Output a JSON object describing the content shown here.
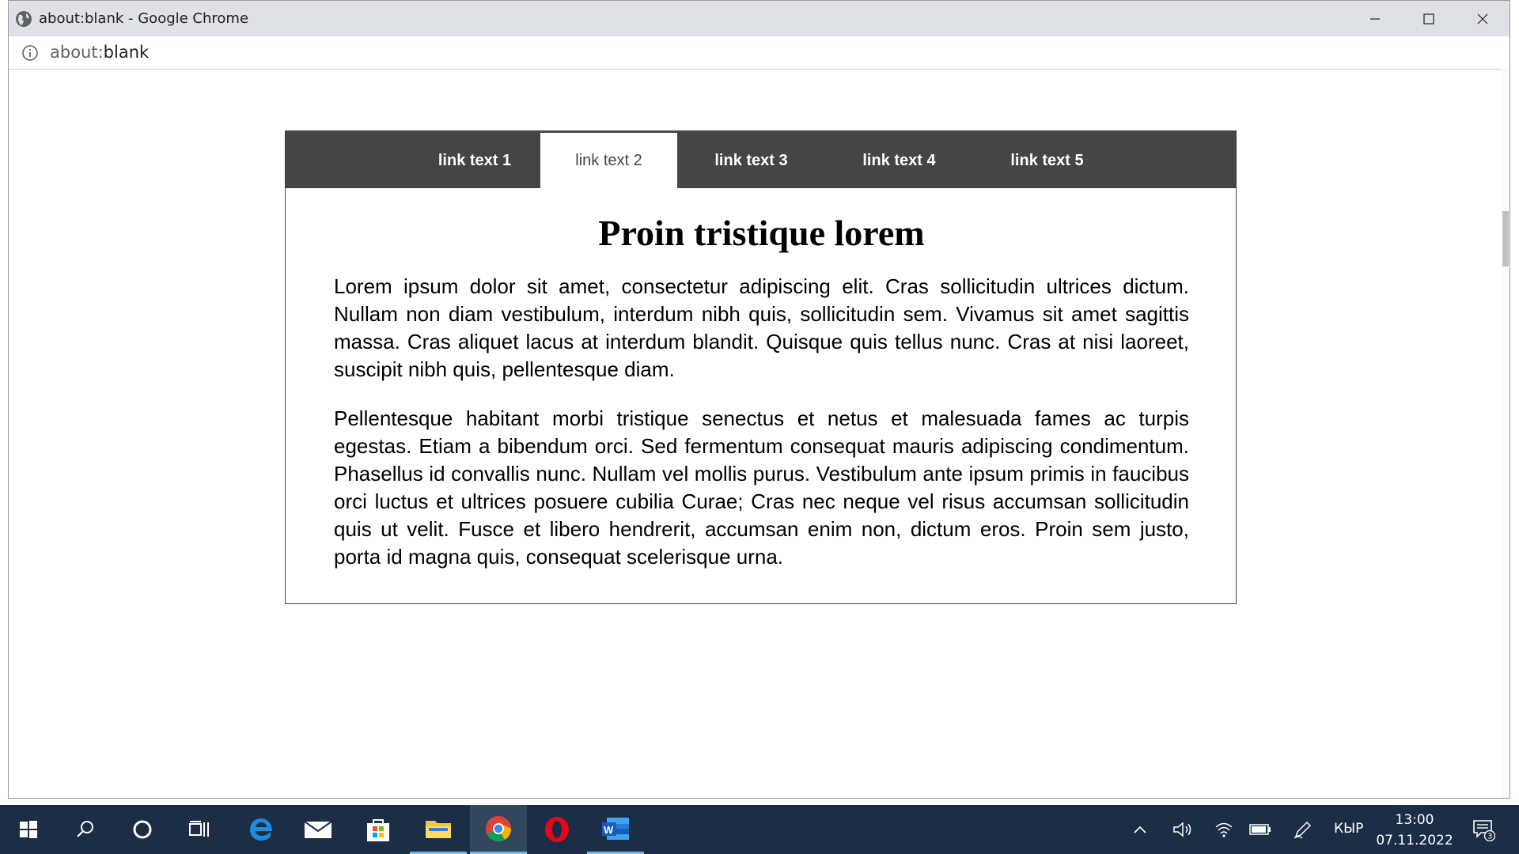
{
  "window": {
    "title": "about:blank - Google Chrome",
    "url_prefix": "about:",
    "url_suffix": "blank"
  },
  "nav": {
    "links": [
      {
        "label": "link text 1",
        "active": false
      },
      {
        "label": "link text 2",
        "active": true
      },
      {
        "label": "link text 3",
        "active": false
      },
      {
        "label": "link text 4",
        "active": false
      },
      {
        "label": "link text 5",
        "active": false
      }
    ]
  },
  "content": {
    "heading": "Proin tristique lorem",
    "paragraphs": [
      "Lorem ipsum dolor sit amet, consectetur adipiscing elit. Cras sollicitudin ultrices dictum. Nullam non diam vestibulum, interdum nibh quis, sollicitudin sem. Vivamus sit amet sagittis massa. Cras aliquet lacus at interdum blandit. Quisque quis tellus nunc. Cras at nisi laoreet, suscipit nibh quis, pellentesque diam.",
      "Pellentesque habitant morbi tristique senectus et netus et malesuada fames ac turpis egestas. Etiam a bibendum orci. Sed fermentum consequat mauris adipiscing condimentum. Phasellus id convallis nunc. Nullam vel mollis purus. Vestibulum ante ipsum primis in faucibus orci luctus et ultrices posuere cubilia Curae; Cras nec neque vel risus accumsan sollicitudin quis ut velit. Fusce et libero hendrerit, accumsan enim non, dictum eros. Proin sem justo, porta id magna quis, consequat scelerisque urna."
    ]
  },
  "taskbar": {
    "language": "КЫР",
    "time": "13:00",
    "date": "07.11.2022",
    "notifications": "3"
  },
  "colors": {
    "navbar": "#454545",
    "taskbar": "#1b2e45",
    "accent": "#76b9ed"
  }
}
